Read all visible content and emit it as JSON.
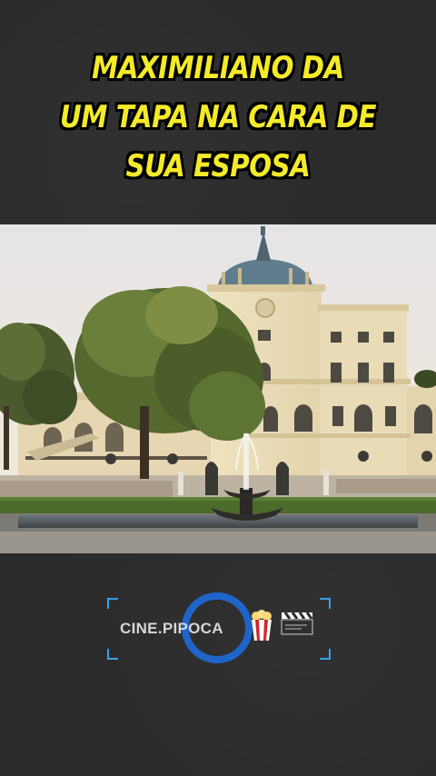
{
  "headline": {
    "line1": "MAXIMILIANO DA",
    "line2": "UM TAPA NA CARA DE",
    "line3": "SUA ESPOSA"
  },
  "photo": {
    "subject": "palace-with-fountain"
  },
  "watermark": {
    "brand_text": "CINE.PIPOCA",
    "icons": [
      "popcorn-icon",
      "clapperboard-icon"
    ],
    "ring_color": "#1f64c9"
  },
  "colors": {
    "headline_fill": "#f4ea28",
    "headline_stroke": "#000000",
    "background": "#2a2a2a"
  }
}
